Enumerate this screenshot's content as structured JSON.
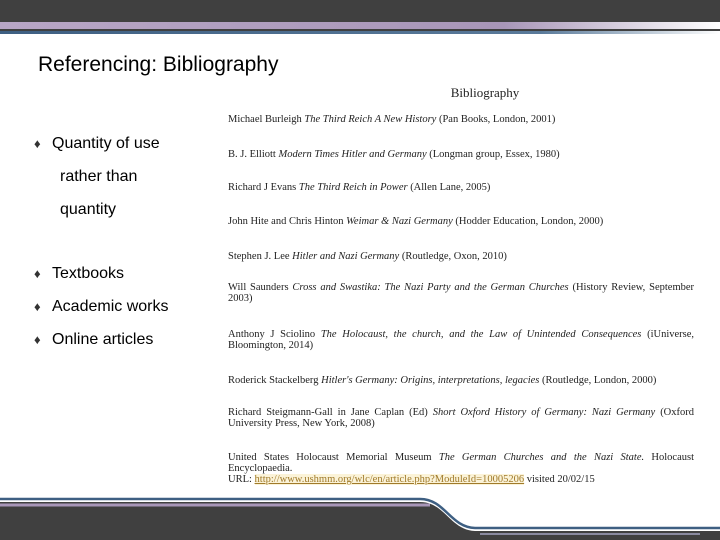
{
  "slide": {
    "title": "Referencing: Bibliography"
  },
  "bullets": [
    {
      "icon": "diamond-bullet-icon",
      "lines": [
        "Quantity of use",
        "rather than",
        "quantity"
      ]
    },
    {
      "icon": "diamond-bullet-icon",
      "lines": [
        "Textbooks"
      ]
    },
    {
      "icon": "diamond-bullet-icon",
      "lines": [
        "Academic works"
      ]
    },
    {
      "icon": "diamond-bullet-icon",
      "lines": [
        "Online articles"
      ]
    }
  ],
  "bibliography": {
    "heading": "Bibliography",
    "entries": [
      {
        "author": "Michael Burleigh",
        "title": "The Third Reich A New History",
        "pub": "(Pan Books, London, 2001)"
      },
      {
        "author": "B. J. Elliott",
        "title": "Modern Times Hitler and Germany",
        "pub": "(Longman group, Essex, 1980)"
      },
      {
        "author": "Richard J Evans",
        "title": "The Third Reich in Power",
        "pub": "(Allen Lane, 2005)"
      },
      {
        "author": "John Hite and Chris Hinton",
        "title": "Weimar & Nazi Germany",
        "pub": "(Hodder Education, London, 2000)"
      },
      {
        "author": "Stephen J. Lee",
        "title": "Hitler and Nazi Germany",
        "pub": "(Routledge, Oxon, 2010)"
      },
      {
        "author": "Will Saunders",
        "title": "Cross and Swastika: The Nazi Party and the German Churches",
        "pub": "(History Review, September 2003)"
      },
      {
        "author": "Anthony J Sciolino",
        "title": "The Holocaust, the church, and the Law of Unintended Consequences",
        "pub": "(iUniverse, Bloomington, 2014)"
      },
      {
        "author": "Roderick Stackelberg",
        "title": "Hitler's Germany: Origins, interpretations, legacies",
        "pub": "(Routledge, London, 2000)"
      },
      {
        "author": "Richard Steigmann-Gall in Jane Caplan (Ed)",
        "title": "Short Oxford History of Germany: Nazi Germany",
        "pub": "(Oxford University Press, New York, 2008)"
      },
      {
        "author": "United States Holocaust Memorial Museum",
        "title": "The German Churches and the Nazi State.",
        "pub": "Holocaust Encyclopaedia."
      }
    ],
    "url_label": "URL:",
    "url": "http://www.ushmm.org/wlc/en/article.php?ModuleId=10005206",
    "visited": "visited 20/02/15"
  },
  "colors": {
    "dark": "#404040",
    "purple": "#b8a6c6",
    "blue": "#3e5f82"
  }
}
